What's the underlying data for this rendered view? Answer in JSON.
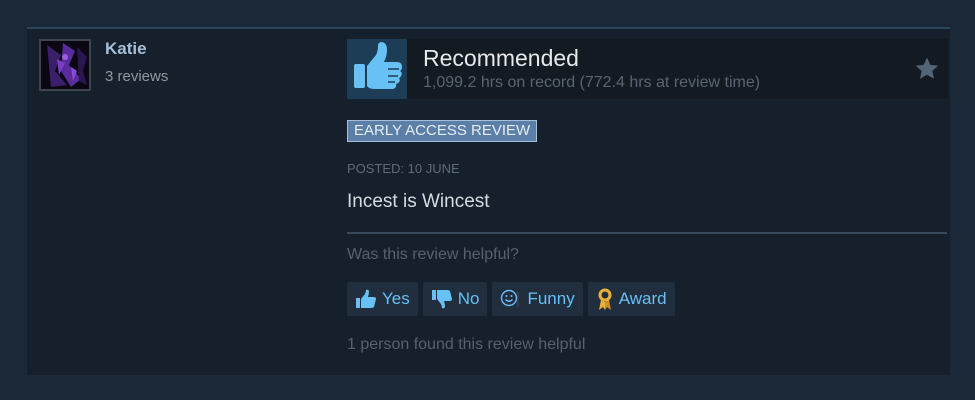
{
  "author": {
    "name": "Katie",
    "reviews": "3 reviews"
  },
  "vote": {
    "title": "Recommended",
    "hours": "1,099.2 hrs on record (772.4 hrs at review time)"
  },
  "badge": "EARLY ACCESS REVIEW",
  "posted": "POSTED: 10 JUNE",
  "review_text": "Incest is Wincest",
  "helpful_question": "Was this review helpful?",
  "buttons": {
    "yes": "Yes",
    "no": "No",
    "funny": "Funny",
    "award": "Award"
  },
  "helpful_count": "1 person found this review helpful",
  "icons": {
    "thumb": "thumbs-up-icon",
    "star": "star-icon",
    "award": "award-ribbon-icon"
  },
  "colors": {
    "accent": "#66c0f4",
    "badge_bg": "#5b7fa6",
    "card_bg": "#16202d",
    "page_bg": "#1b2838",
    "award_gold": "#e8b23a"
  }
}
